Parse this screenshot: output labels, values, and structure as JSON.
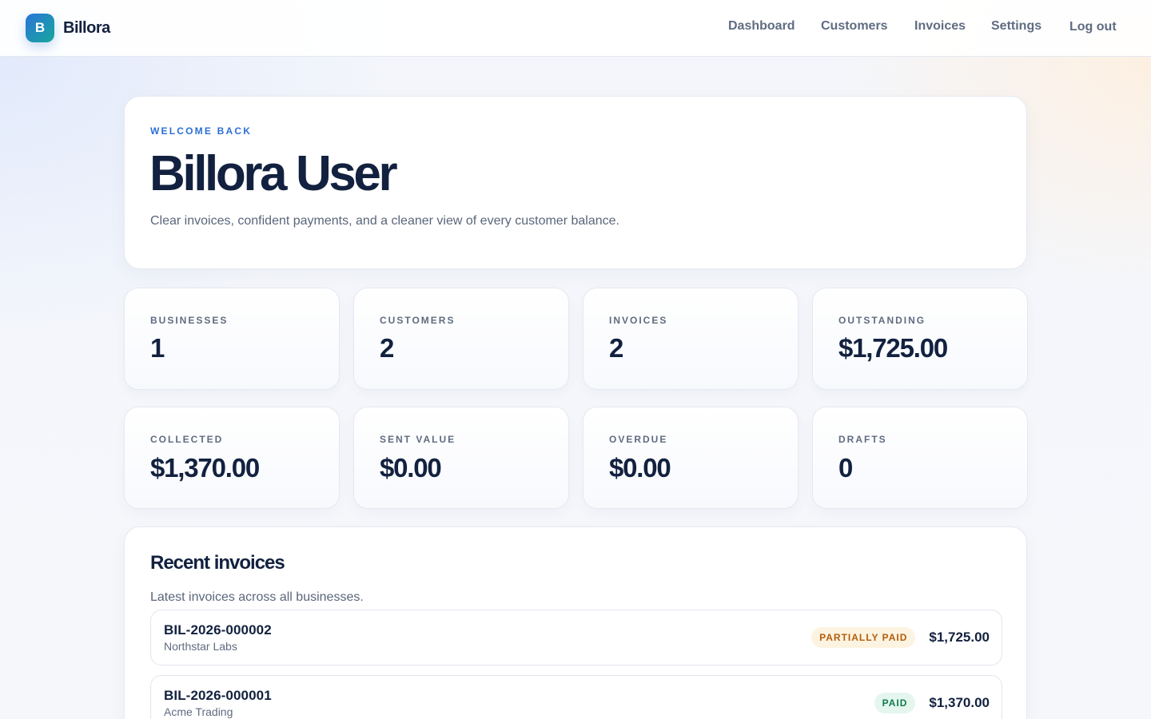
{
  "app": {
    "logo_letter": "B",
    "name": "Billora"
  },
  "nav": {
    "items": [
      "Dashboard",
      "Customers",
      "Invoices",
      "Settings"
    ],
    "logout_label": "Log out"
  },
  "hero": {
    "eyebrow": "WELCOME BACK",
    "title": "Billora User",
    "subtitle": "Clear invoices, confident payments, and a cleaner view of every customer balance."
  },
  "stats": [
    {
      "label": "BUSINESSES",
      "value": "1"
    },
    {
      "label": "CUSTOMERS",
      "value": "2"
    },
    {
      "label": "INVOICES",
      "value": "2"
    },
    {
      "label": "OUTSTANDING",
      "value": "$1,725.00"
    },
    {
      "label": "COLLECTED",
      "value": "$1,370.00"
    },
    {
      "label": "SENT VALUE",
      "value": "$0.00"
    },
    {
      "label": "OVERDUE",
      "value": "$0.00"
    },
    {
      "label": "DRAFTS",
      "value": "0"
    }
  ],
  "recent": {
    "title": "Recent invoices",
    "subtitle": "Latest invoices across all businesses.",
    "invoices": [
      {
        "number": "BIL-2026-000002",
        "customer": "Northstar Labs",
        "status": "PARTIALLY PAID",
        "amount": "$1,725.00"
      },
      {
        "number": "BIL-2026-000001",
        "customer": "Acme Trading",
        "status": "PAID",
        "amount": "$1,370.00"
      }
    ]
  },
  "colors": {
    "accent": "#2c6fd6",
    "brand_gradient_start": "#2a74d9",
    "brand_gradient_end": "#17a89a",
    "status_partially_paid": "#b45d0a",
    "status_paid": "#137a4c"
  }
}
